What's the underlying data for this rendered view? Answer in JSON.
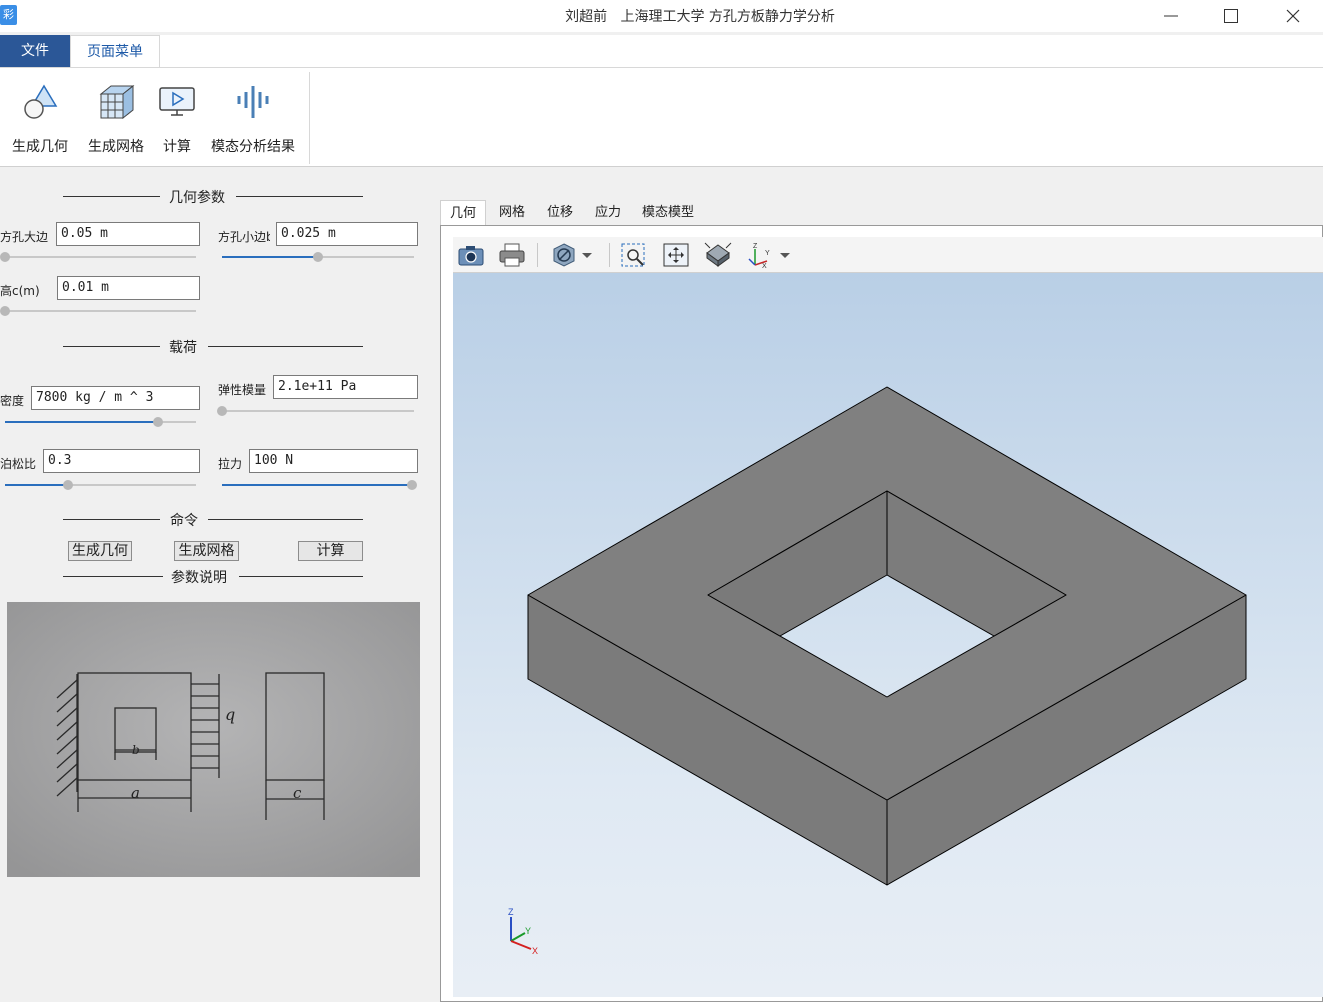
{
  "window": {
    "title": "刘超前   上海理工大学 方孔方板静力学分析",
    "app_icon": "app-logo-icon",
    "controls": [
      "minimize-icon",
      "maximize-icon",
      "close-icon"
    ]
  },
  "ribbon": {
    "tabs": [
      {
        "label": "文件"
      },
      {
        "label": "页面菜单"
      }
    ],
    "buttons": [
      {
        "label": "生成几何",
        "icon": "geometry-icon"
      },
      {
        "label": "生成网格",
        "icon": "mesh-icon"
      },
      {
        "label": "计算",
        "icon": "compute-icon"
      },
      {
        "label": "模态分析结果",
        "icon": "modal-result-icon"
      }
    ]
  },
  "left_panel": {
    "geometry_section": "几何参数",
    "hole_big": {
      "label": "方孔大边",
      "value": "0.05 m",
      "slider_fraction": 0.0
    },
    "hole_small": {
      "label": "方孔小边b",
      "value": "0.025 m",
      "slider_fraction": 0.5
    },
    "height": {
      "label": "高c(m)",
      "value": "0.01 m",
      "slider_fraction": 0.0
    },
    "load_section": "载荷",
    "density": {
      "label": "密度",
      "value": "7800 kg / m ^ 3",
      "slider_fraction": 0.8
    },
    "elastic_modulus": {
      "label": "弹性模量",
      "value": "2.1e+11 Pa",
      "slider_fraction": 0.0
    },
    "poisson": {
      "label": "泊松比",
      "value": "0.3",
      "slider_fraction": 0.33
    },
    "tension": {
      "label": "拉力",
      "value": "100 N",
      "slider_fraction": 1.0
    },
    "command_section": "命令",
    "cmd_buttons": [
      {
        "label": "生成几何"
      },
      {
        "label": "生成网格"
      },
      {
        "label": "计算"
      }
    ],
    "param_section": "参数说明",
    "sketch_labels": {
      "q": "q",
      "b": "b",
      "a": "a",
      "c": "c"
    }
  },
  "view_tabs": [
    {
      "label": "几何",
      "active": true
    },
    {
      "label": "网格"
    },
    {
      "label": "位移"
    },
    {
      "label": "应力"
    },
    {
      "label": "模态模型"
    }
  ],
  "view_toolbar": [
    "camera-icon",
    "print-icon",
    "display-mode-icon",
    "dropdown-arrow-icon",
    "zoom-box-icon",
    "fit-all-icon",
    "iso-view-icon",
    "axis-orientation-icon",
    "dropdown-arrow-icon"
  ],
  "triad": {
    "z": "Z",
    "y": "Y",
    "x": "X"
  },
  "colors": {
    "model_face": "#808080",
    "accent": "#2b5797"
  }
}
